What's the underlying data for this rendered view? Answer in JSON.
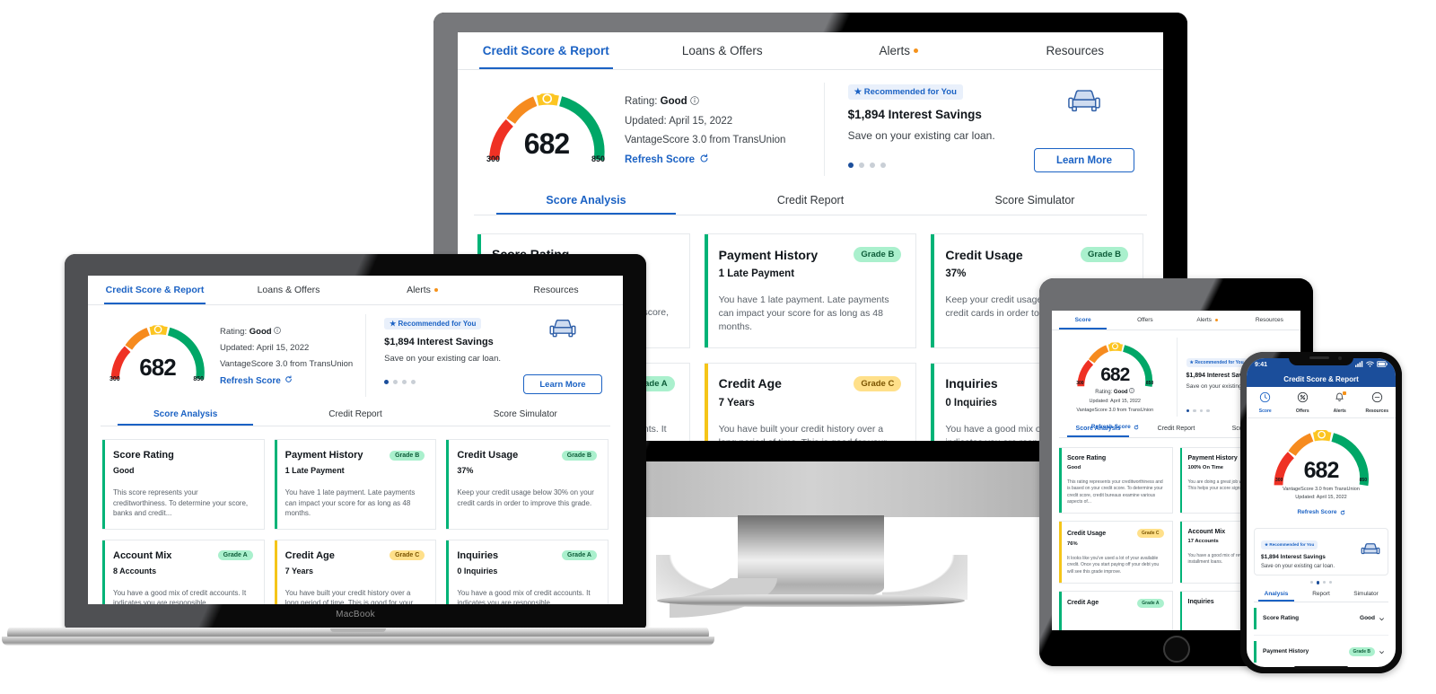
{
  "app": {
    "nav": [
      {
        "label": "Credit Score & Report",
        "active": true,
        "badge": false
      },
      {
        "label": "Loans & Offers",
        "active": false,
        "badge": false
      },
      {
        "label": "Alerts",
        "active": false,
        "badge": true
      },
      {
        "label": "Resources",
        "active": false,
        "badge": false
      }
    ],
    "nav_tablet": [
      {
        "label": "Score",
        "active": true,
        "badge": false
      },
      {
        "label": "Offers",
        "active": false,
        "badge": false
      },
      {
        "label": "Alerts",
        "active": false,
        "badge": true
      },
      {
        "label": "Resources",
        "active": false,
        "badge": false
      }
    ],
    "subtabs": [
      {
        "label": "Score Analysis",
        "active": true
      },
      {
        "label": "Credit Report",
        "active": false
      },
      {
        "label": "Score Simulator",
        "active": false
      }
    ],
    "subtabs_phone": [
      {
        "label": "Analysis",
        "active": true
      },
      {
        "label": "Report",
        "active": false
      },
      {
        "label": "Simulator",
        "active": false
      }
    ]
  },
  "score": {
    "value": "682",
    "min": "300",
    "max": "850",
    "rating_label": "Rating:",
    "rating_value": "Good",
    "updated": "Updated: April 15, 2022",
    "bureau": "VantageScore 3.0 from TransUnion",
    "refresh": "Refresh Score",
    "colors": {
      "red": "#ef3124",
      "orange": "#f68b1f",
      "yellow": "#fcc521",
      "green": "#00a767",
      "track": "#e6e9ec",
      "brand_blue": "#1b62c4",
      "dark_blue": "#1b4e9b"
    }
  },
  "offer": {
    "badge": "Recommended for You",
    "title": "$1,894 Interest Savings",
    "subtitle": "Save on your existing car loan.",
    "button": "Learn More",
    "dots": 4,
    "active_dot": 0,
    "icon": "car-icon"
  },
  "desktop_cards": [
    {
      "title": "Score Rating",
      "grade": "",
      "grade_class": "",
      "edge": "#00b377",
      "value": "Good",
      "desc": "This score represents your creditworthiness. To determine your score, banks and credit..."
    },
    {
      "title": "Payment History",
      "grade": "Grade B",
      "grade_class": "g-b",
      "edge": "#00b377",
      "value": "1 Late Payment",
      "desc": "You have 1 late payment. Late payments can impact your score for as long as 48 months."
    },
    {
      "title": "Credit Usage",
      "grade": "Grade B",
      "grade_class": "g-b",
      "edge": "#00b377",
      "value": "37%",
      "desc": "Keep your credit usage below 30% on your credit cards in order to improve this grade."
    },
    {
      "title": "Account Mix",
      "grade": "Grade A",
      "grade_class": "g-a",
      "edge": "#00b377",
      "value": "8 Accounts",
      "desc": "You have a good mix of credit accounts. It indicates you are responsible."
    },
    {
      "title": "Credit Age",
      "grade": "Grade C",
      "grade_class": "g-c",
      "edge": "#f5c518",
      "value": "7 Years",
      "desc": "You have built your credit history over a long period of time. This is good for your score."
    },
    {
      "title": "Inquiries",
      "grade": "Grade A",
      "grade_class": "g-a",
      "edge": "#00b377",
      "value": "0 Inquiries",
      "desc": "You have a good mix of credit accounts. It indicates you are responsible."
    }
  ],
  "tablet_cards": [
    {
      "title": "Score Rating",
      "grade": "",
      "grade_class": "",
      "edge": "#00b377",
      "value": "Good",
      "desc": "This rating represents your creditworthiness and is based on your credit score. To determine your credit score, credit bureaus examine various aspects of..."
    },
    {
      "title": "Payment History",
      "grade": "",
      "grade_class": "",
      "edge": "#00b377",
      "value": "100% On Time",
      "desc": "You are doing a great job with paying on time. This helps your score significantly."
    },
    {
      "title": "Credit Usage",
      "grade": "Grade C",
      "grade_class": "g-c",
      "edge": "#f5c518",
      "value": "76%",
      "desc": "It looks like you've used a lot of your available credit. Once you start paying off your debt you will see this grade improve."
    },
    {
      "title": "Account Mix",
      "grade": "",
      "grade_class": "",
      "edge": "#00b377",
      "value": "17 Accounts",
      "desc": "You have a good mix of revolving and installment loans."
    },
    {
      "title": "Credit Age",
      "grade": "Grade A",
      "grade_class": "g-a",
      "edge": "#00b377",
      "value": "",
      "desc": ""
    },
    {
      "title": "Inquiries",
      "grade": "",
      "grade_class": "",
      "edge": "#00b377",
      "value": "",
      "desc": ""
    }
  ],
  "phone": {
    "status_time": "9:41",
    "app_title": "Credit Score & Report",
    "icon_nav": [
      {
        "label": "Score",
        "icon": "speedometer-icon",
        "active": true,
        "badge": false
      },
      {
        "label": "Offers",
        "icon": "tag-icon",
        "active": false,
        "badge": false
      },
      {
        "label": "Alerts",
        "icon": "bell-icon",
        "active": false,
        "badge": true
      },
      {
        "label": "Resources",
        "icon": "minus-circle-icon",
        "active": false,
        "badge": false
      }
    ],
    "accordion": [
      {
        "title": "Score Rating",
        "value": "Good",
        "grade_class": "",
        "edge": "#00b377"
      },
      {
        "title": "Payment History",
        "value": "Grade B",
        "grade_class": "g-b",
        "edge": "#00b377"
      }
    ]
  },
  "laptop": {
    "brand": "MacBook"
  }
}
